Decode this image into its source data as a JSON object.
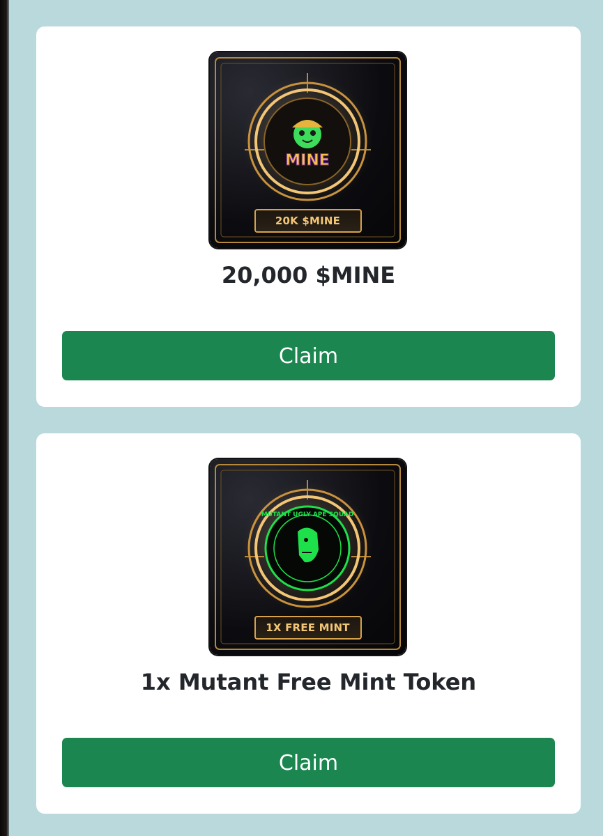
{
  "rewards": [
    {
      "plate_text": "20K $MINE",
      "emblem_text": "MINE",
      "title": "20,000 $MINE",
      "button_label": "Claim",
      "emblem_color": "#3ddc5b"
    },
    {
      "plate_text": "1X FREE MINT",
      "emblem_text": "MUTANT UGLY APE SQUAD",
      "title": "1x Mutant Free Mint Token",
      "button_label": "Claim",
      "emblem_color": "#1ee04a"
    }
  ],
  "colors": {
    "background": "#b9d9dd",
    "card": "#ffffff",
    "button": "#1c8650",
    "gold": "#d8a24a"
  }
}
